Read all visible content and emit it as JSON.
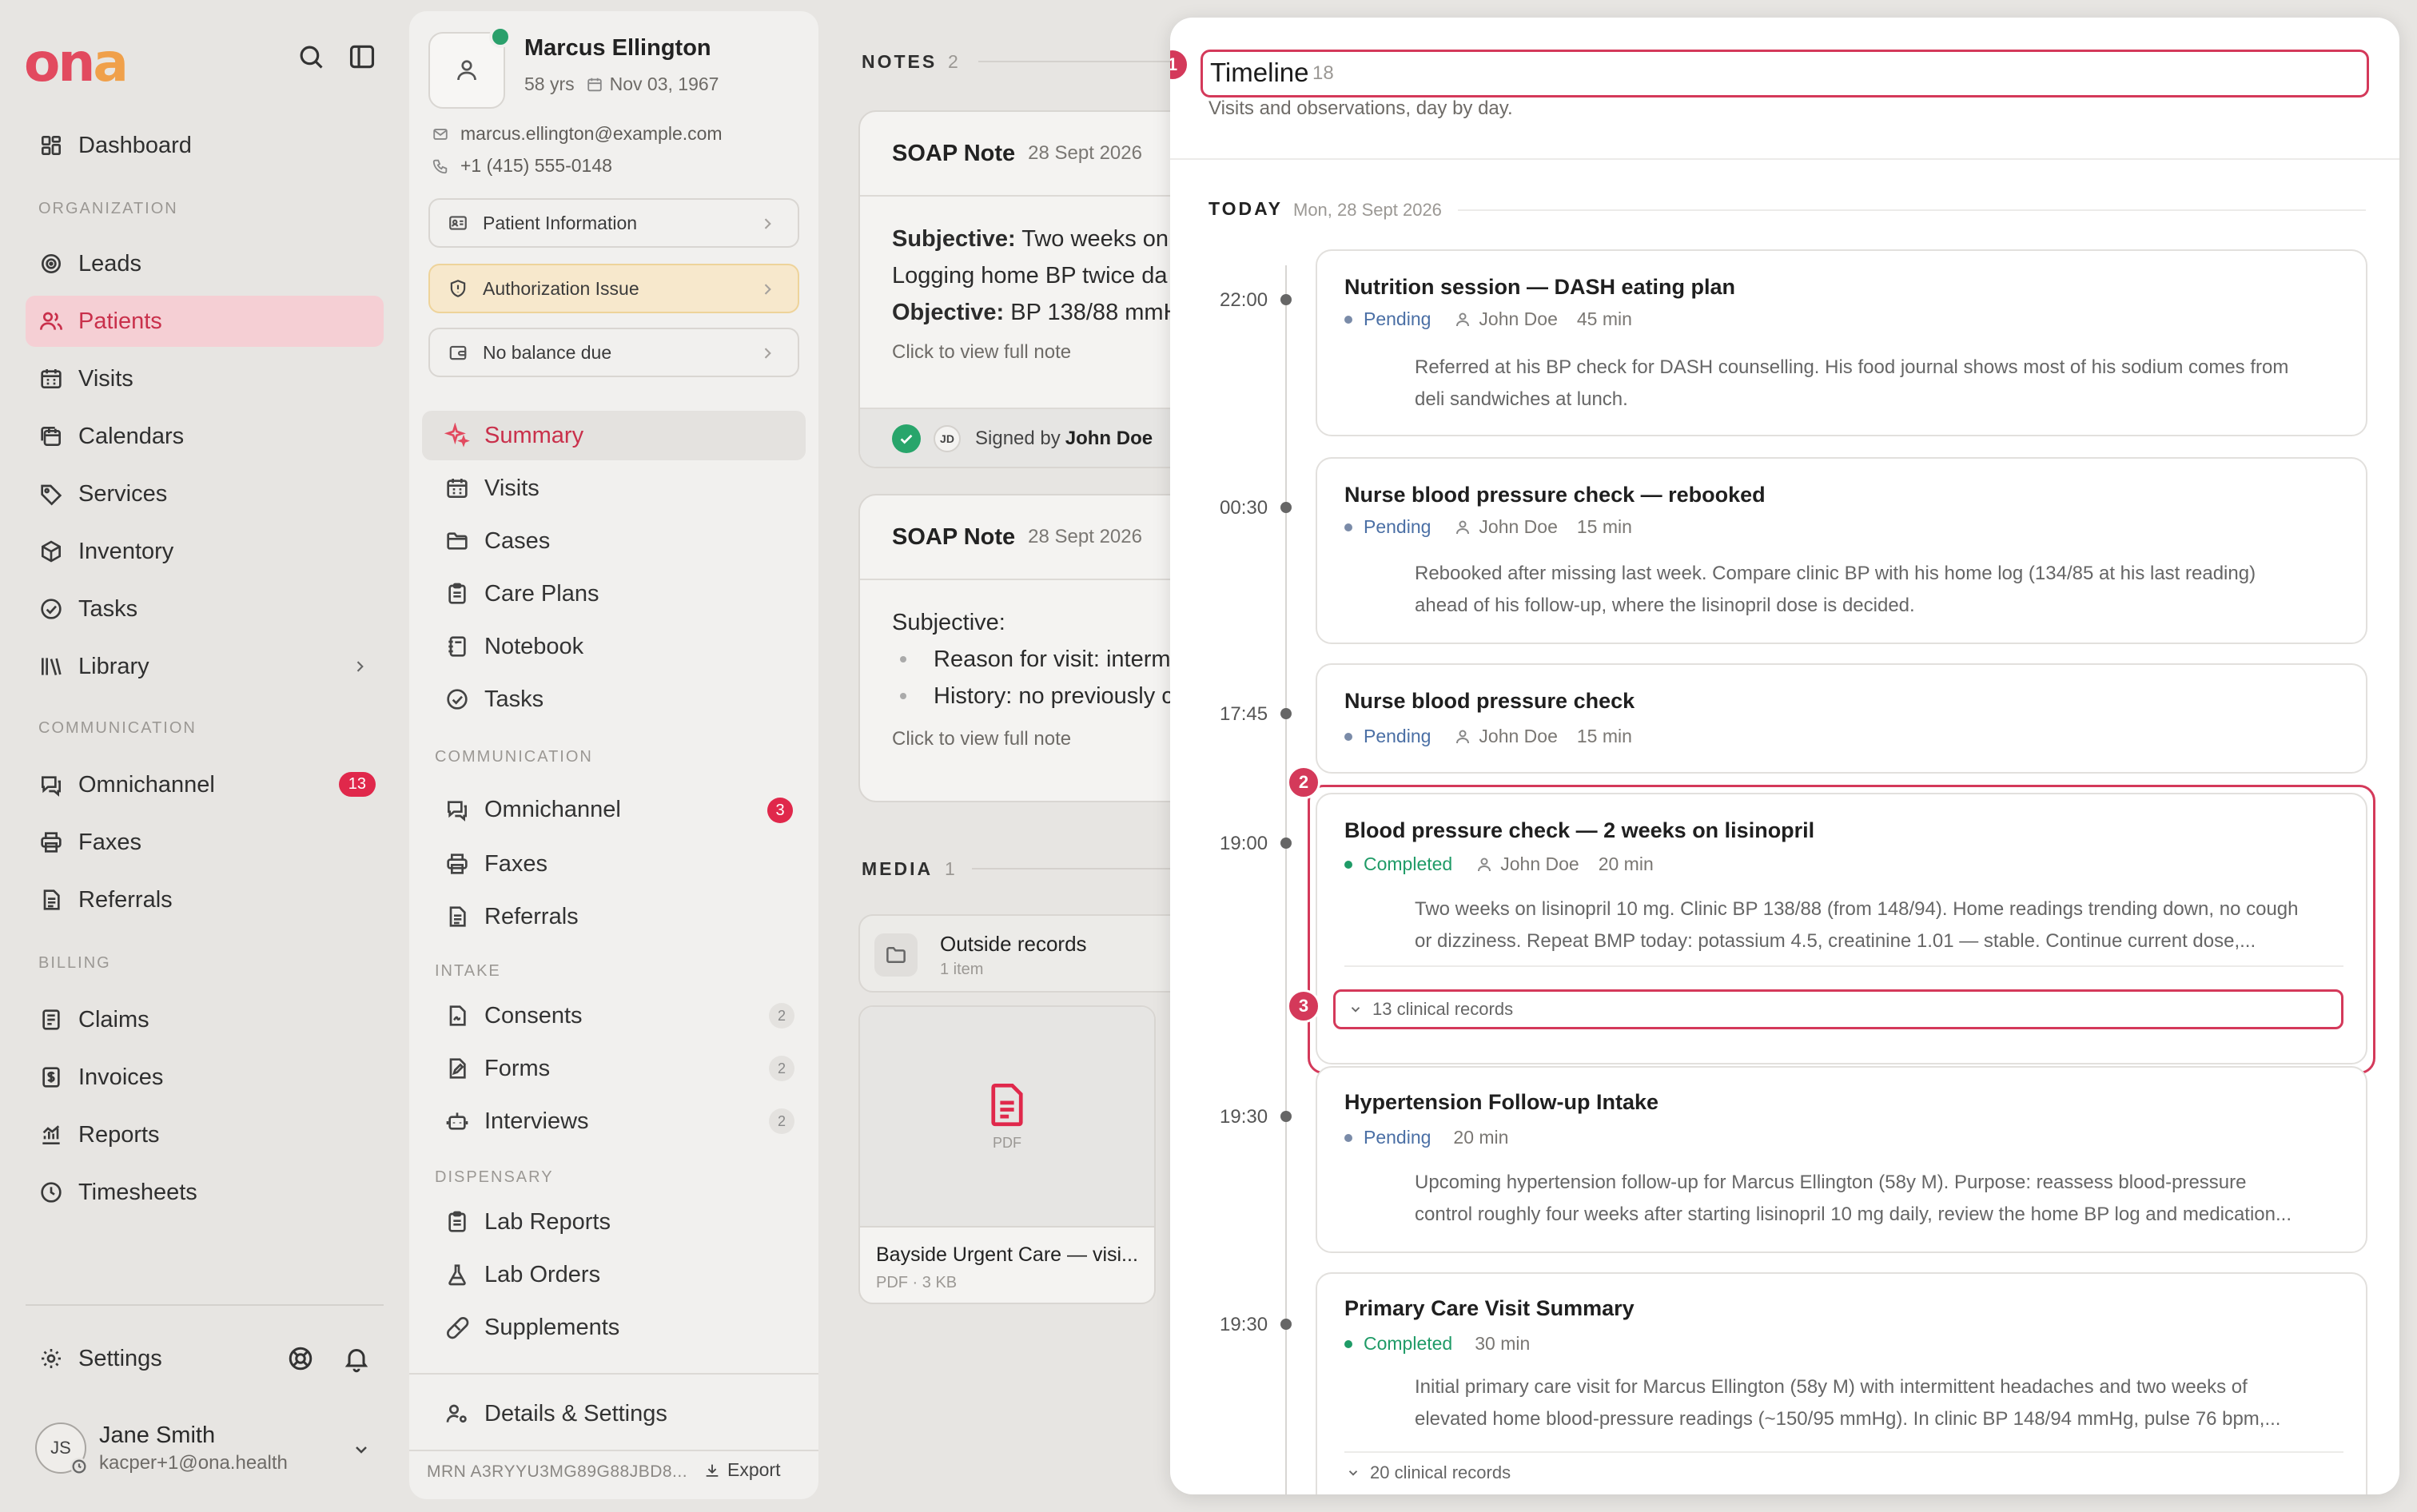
{
  "app": {
    "logo_main": "on",
    "logo_accent": "a"
  },
  "sidebar": {
    "dashboard": "Dashboard",
    "sections": {
      "organization": "ORGANIZATION",
      "communication": "COMMUNICATION",
      "billing": "BILLING"
    },
    "items": {
      "leads": "Leads",
      "patients": "Patients",
      "visits": "Visits",
      "calendars": "Calendars",
      "services": "Services",
      "inventory": "Inventory",
      "tasks": "Tasks",
      "library": "Library",
      "omnichannel": "Omnichannel",
      "omnichannel_badge": "13",
      "faxes": "Faxes",
      "referrals": "Referrals",
      "claims": "Claims",
      "invoices": "Invoices",
      "reports": "Reports",
      "timesheets": "Timesheets"
    },
    "settings": "Settings",
    "user": {
      "initials": "JS",
      "name": "Jane Smith",
      "email": "kacper+1@ona.health"
    }
  },
  "patient": {
    "name": "Marcus Ellington",
    "age": "58 yrs",
    "dob": "Nov 03, 1967",
    "email": "marcus.ellington@example.com",
    "phone": "+1 (415) 555-0148",
    "buttons": {
      "info": "Patient Information",
      "auth": "Authorization Issue",
      "balance": "No balance due"
    },
    "menu": {
      "summary": "Summary",
      "visits": "Visits",
      "cases": "Cases",
      "care_plans": "Care Plans",
      "notebook": "Notebook",
      "tasks": "Tasks",
      "sec_communication": "COMMUNICATION",
      "omnichannel": "Omnichannel",
      "omnichannel_badge": "3",
      "faxes": "Faxes",
      "referrals": "Referrals",
      "sec_intake": "INTAKE",
      "consents": "Consents",
      "consents_count": "2",
      "forms": "Forms",
      "forms_count": "2",
      "interviews": "Interviews",
      "interviews_count": "2",
      "sec_dispensary": "DISPENSARY",
      "lab_reports": "Lab Reports",
      "lab_orders": "Lab Orders",
      "supplements": "Supplements",
      "details_settings": "Details & Settings"
    },
    "mrn": "MRN A3RYYU3MG89G88JBD8...",
    "export": "Export"
  },
  "notes": {
    "label": "NOTES",
    "count": "2",
    "items": [
      {
        "title": "SOAP Note",
        "date": "28 Sept 2026",
        "line1_bold": "Subjective:",
        "line1": " Two weeks on",
        "line2": "Logging home BP twice da",
        "line3_bold": "Objective:",
        "line3": " BP 138/88 mmH",
        "link": "Click to view full note",
        "signer_initials": "JD",
        "signed_by": "Signed by ",
        "signer": "John Doe"
      },
      {
        "title": "SOAP Note",
        "date": "28 Sept 2026",
        "heading": "Subjective:",
        "bullet1": "Reason for visit: interm",
        "bullet2": "History: no previously c",
        "link": "Click to view full note"
      }
    ]
  },
  "media": {
    "label": "MEDIA",
    "count": "1",
    "folder": {
      "name": "Outside records",
      "count": "1 item"
    },
    "file": {
      "type": "PDF",
      "name": "Bayside Urgent Care — visi...",
      "meta": "PDF · 3 KB"
    }
  },
  "timeline": {
    "title": "Timeline",
    "count": "18",
    "subtitle": "Visits and observations, day by day.",
    "day_label": "TODAY",
    "day_date": "Mon, 28 Sept 2026",
    "markers": [
      "1",
      "2",
      "3"
    ],
    "entries": [
      {
        "time": "22:00",
        "title": "Nutrition session — DASH eating plan",
        "status": "Pending",
        "who": "John Doe",
        "duration": "45 min",
        "desc1": "Referred at his BP check for DASH counselling. His food journal shows most of his sodium comes from",
        "desc2": "deli sandwiches at lunch."
      },
      {
        "time": "00:30",
        "title": "Nurse blood pressure check — rebooked",
        "status": "Pending",
        "who": "John Doe",
        "duration": "15 min",
        "desc1": "Rebooked after missing last week. Compare clinic BP with his home log (134/85 at his last reading)",
        "desc2": "ahead of his follow-up, where the lisinopril dose is decided."
      },
      {
        "time": "17:45",
        "title": "Nurse blood pressure check",
        "status": "Pending",
        "who": "John Doe",
        "duration": "15 min"
      },
      {
        "time": "19:00",
        "title": "Blood pressure check — 2 weeks on lisinopril",
        "status": "Completed",
        "who": "John Doe",
        "duration": "20 min",
        "desc1": "Two weeks on lisinopril 10 mg. Clinic BP 138/88 (from 148/94). Home readings trending down, no cough",
        "desc2": "or dizziness. Repeat BMP today: potassium 4.5, creatinine 1.01 — stable. Continue current dose,...",
        "records": "13 clinical records"
      },
      {
        "time": "19:30",
        "title": "Hypertension Follow-up Intake",
        "status": "Pending",
        "duration": "20 min",
        "desc1": "Upcoming hypertension follow-up for Marcus Ellington (58y M). Purpose: reassess blood-pressure",
        "desc2": "control roughly four weeks after starting lisinopril 10 mg daily, review the home BP log and medication..."
      },
      {
        "time": "19:30",
        "title": "Primary Care Visit Summary",
        "status": "Completed",
        "duration": "30 min",
        "desc1": "Initial primary care visit for Marcus Ellington (58y M) with intermittent headaches and two weeks of",
        "desc2": "elevated home blood-pressure readings (~150/95 mmHg). In clinic BP 148/94 mmHg, pulse 76 bpm,...",
        "records": "20 clinical records"
      }
    ]
  },
  "colors": {
    "accent": "#e24a5f",
    "accent_dark": "#c9304b",
    "highlight": "#d4395a",
    "pending": "#4a6fa5",
    "completed": "#1f9b67"
  }
}
